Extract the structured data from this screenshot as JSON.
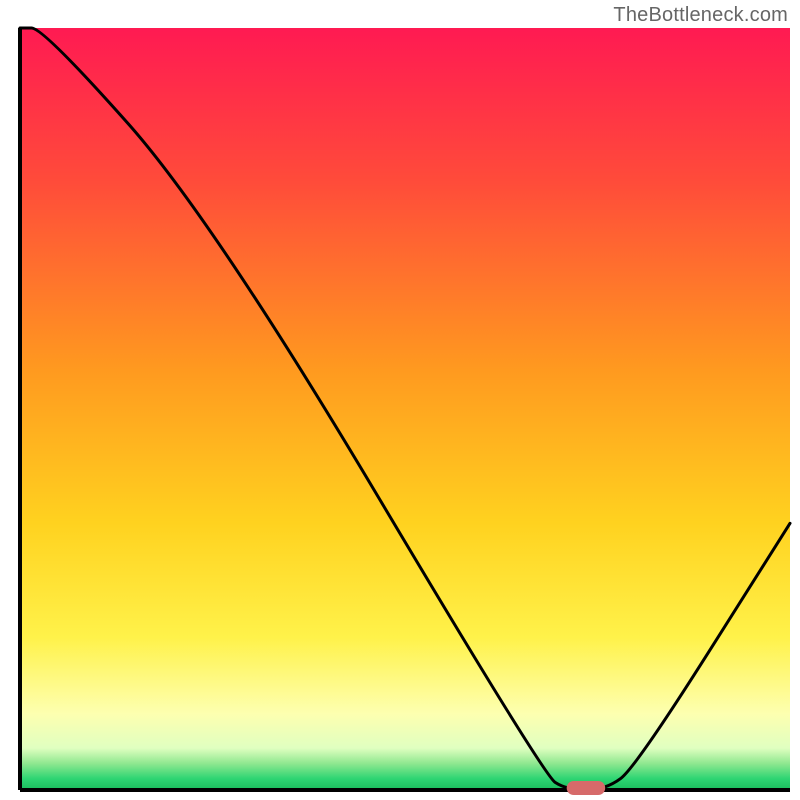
{
  "watermark": "TheBottleneck.com",
  "chart_data": {
    "type": "line",
    "title": "",
    "xlabel": "",
    "ylabel": "",
    "xlim": [
      0,
      100
    ],
    "ylim": [
      0,
      100
    ],
    "x": [
      0,
      3,
      25,
      68,
      71,
      76,
      80,
      100
    ],
    "values": [
      100,
      100,
      75,
      2,
      0,
      0,
      3,
      35
    ],
    "marker": {
      "x_start": 71,
      "x_end": 76,
      "y": 0,
      "color": "#d66a6a"
    },
    "gradient_stops": [
      {
        "offset": 0.0,
        "color": "#ff1a52"
      },
      {
        "offset": 0.2,
        "color": "#ff4b3a"
      },
      {
        "offset": 0.45,
        "color": "#ff9a1f"
      },
      {
        "offset": 0.65,
        "color": "#ffd21f"
      },
      {
        "offset": 0.8,
        "color": "#fff24a"
      },
      {
        "offset": 0.9,
        "color": "#fdffb0"
      },
      {
        "offset": 0.945,
        "color": "#e0ffc0"
      },
      {
        "offset": 0.965,
        "color": "#90e890"
      },
      {
        "offset": 0.985,
        "color": "#2ed573"
      },
      {
        "offset": 1.0,
        "color": "#1abc5c"
      }
    ],
    "axis_color": "#000000",
    "curve_color": "#000000",
    "curve_width": 3
  }
}
